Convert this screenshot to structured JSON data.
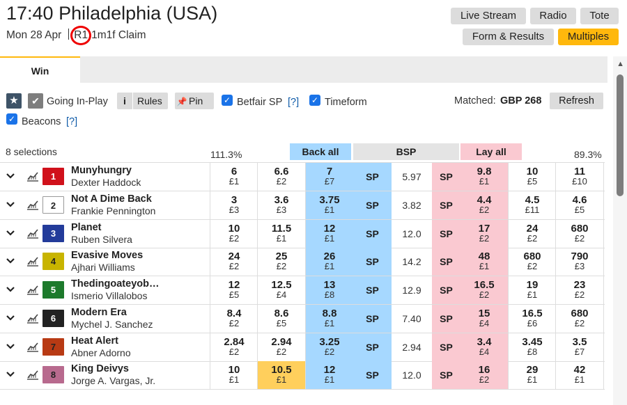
{
  "header": {
    "title": "17:40 Philadelphia (USA)",
    "date": "Mon 28 Apr",
    "race_no": "R1",
    "race_desc": "1m1f Claim",
    "buttons": {
      "live_stream": "Live Stream",
      "radio": "Radio",
      "tote": "Tote",
      "form_results": "Form & Results",
      "multiples": "Multiples"
    }
  },
  "tabs": {
    "win": "Win"
  },
  "controls": {
    "going_inplay": "Going In-Play",
    "rules_icon": "i",
    "rules": "Rules",
    "pin": "Pin",
    "betfair_sp": "Betfair SP",
    "help": "[?]",
    "timeform": "Timeform",
    "beacons": "Beacons",
    "matched_label": "Matched:",
    "matched_value": "GBP 268",
    "refresh": "Refresh"
  },
  "market": {
    "selections": "8 selections",
    "back_pct": "111.3%",
    "lay_pct": "89.3%",
    "back_all": "Back all",
    "bsp": "BSP",
    "lay_all": "Lay all",
    "sp": "SP"
  },
  "runners": [
    {
      "no": "1",
      "name": "Munyhungry",
      "jockey": "Dexter Haddock",
      "cloth_bg": "#d0111b",
      "cloth_fg": "#ffffff",
      "back": [
        [
          "6",
          "£1"
        ],
        [
          "6.6",
          "£2"
        ],
        [
          "7",
          "£7"
        ]
      ],
      "bsp": "5.97",
      "lay": [
        [
          "9.8",
          "£1"
        ],
        [
          "10",
          "£5"
        ],
        [
          "11",
          "£10"
        ]
      ]
    },
    {
      "no": "2",
      "name": "Not A Dime Back",
      "jockey": "Frankie Pennington",
      "cloth_bg": "#ffffff",
      "cloth_fg": "#222222",
      "back": [
        [
          "3",
          "£3"
        ],
        [
          "3.6",
          "£3"
        ],
        [
          "3.75",
          "£1"
        ]
      ],
      "bsp": "3.82",
      "lay": [
        [
          "4.4",
          "£2"
        ],
        [
          "4.5",
          "£11"
        ],
        [
          "4.6",
          "£5"
        ]
      ]
    },
    {
      "no": "3",
      "name": "Planet",
      "jockey": "Ruben Silvera",
      "cloth_bg": "#233b9a",
      "cloth_fg": "#ffffff",
      "back": [
        [
          "10",
          "£2"
        ],
        [
          "11.5",
          "£1"
        ],
        [
          "12",
          "£1"
        ]
      ],
      "bsp": "12.0",
      "lay": [
        [
          "17",
          "£2"
        ],
        [
          "24",
          "£2"
        ],
        [
          "680",
          "£2"
        ]
      ]
    },
    {
      "no": "4",
      "name": "Evasive Moves",
      "jockey": "Ajhari Williams",
      "cloth_bg": "#c8b400",
      "cloth_fg": "#222222",
      "back": [
        [
          "24",
          "£2"
        ],
        [
          "25",
          "£2"
        ],
        [
          "26",
          "£1"
        ]
      ],
      "bsp": "14.2",
      "lay": [
        [
          "48",
          "£1"
        ],
        [
          "680",
          "£2"
        ],
        [
          "790",
          "£3"
        ]
      ]
    },
    {
      "no": "5",
      "name": "Thedingoateyob…",
      "jockey": "Ismerio Villalobos",
      "cloth_bg": "#1d7a2c",
      "cloth_fg": "#ffffff",
      "back": [
        [
          "12",
          "£5"
        ],
        [
          "12.5",
          "£4"
        ],
        [
          "13",
          "£8"
        ]
      ],
      "bsp": "12.9",
      "lay": [
        [
          "16.5",
          "£2"
        ],
        [
          "19",
          "£1"
        ],
        [
          "23",
          "£2"
        ]
      ]
    },
    {
      "no": "6",
      "name": "Modern Era",
      "jockey": "Mychel J. Sanchez",
      "cloth_bg": "#222222",
      "cloth_fg": "#ffffff",
      "back": [
        [
          "8.4",
          "£2"
        ],
        [
          "8.6",
          "£5"
        ],
        [
          "8.8",
          "£1"
        ]
      ],
      "bsp": "7.40",
      "lay": [
        [
          "15",
          "£4"
        ],
        [
          "16.5",
          "£6"
        ],
        [
          "680",
          "£2"
        ]
      ]
    },
    {
      "no": "7",
      "name": "Heat Alert",
      "jockey": "Abner Adorno",
      "cloth_bg": "#b83a14",
      "cloth_fg": "#222222",
      "back": [
        [
          "2.84",
          "£2"
        ],
        [
          "2.94",
          "£2"
        ],
        [
          "3.25",
          "£2"
        ]
      ],
      "bsp": "2.94",
      "lay": [
        [
          "3.4",
          "£4"
        ],
        [
          "3.45",
          "£8"
        ],
        [
          "3.5",
          "£7"
        ]
      ]
    },
    {
      "no": "8",
      "name": "King Deivys",
      "jockey": "Jorge A. Vargas, Jr.",
      "cloth_bg": "#b86a8e",
      "cloth_fg": "#222222",
      "back": [
        [
          "10",
          "£1"
        ],
        [
          "10.5",
          "£1"
        ],
        [
          "12",
          "£1"
        ]
      ],
      "bsp": "12.0",
      "lay": [
        [
          "16",
          "£2"
        ],
        [
          "29",
          "£1"
        ],
        [
          "42",
          "£1"
        ]
      ]
    }
  ]
}
